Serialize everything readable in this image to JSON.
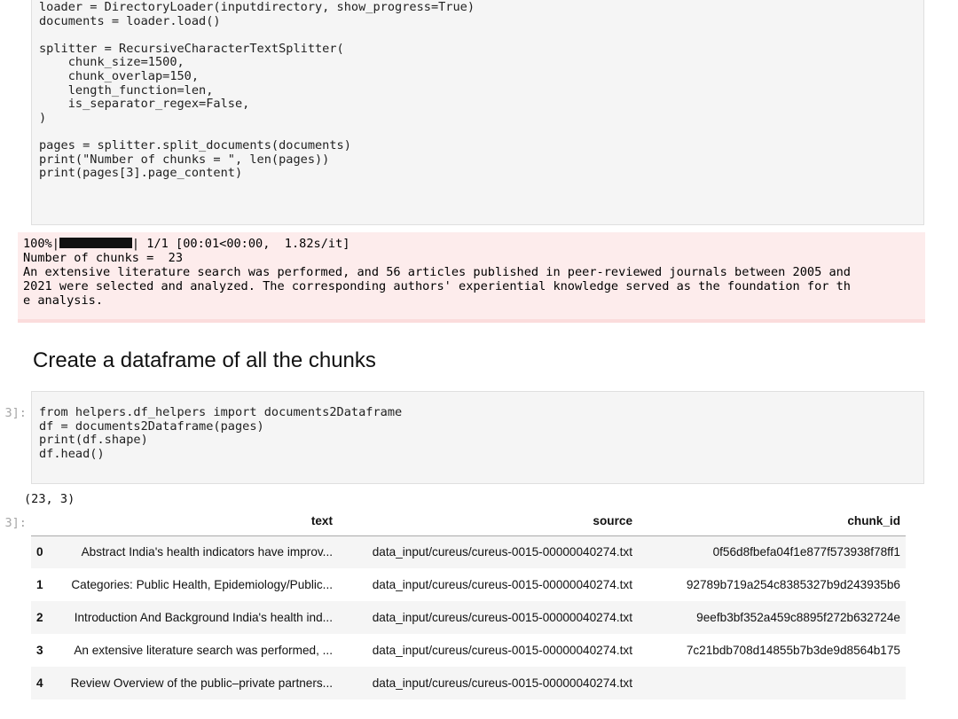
{
  "cell1": {
    "lines": [
      "loader = DirectoryLoader(inputdirectory, show_progress=True)",
      "documents = loader.load()",
      "",
      "splitter = RecursiveCharacterTextSplitter(",
      "    chunk_size=1500,",
      "    chunk_overlap=150,",
      "    length_function=len,",
      "    is_separator_regex=False,",
      ")",
      "",
      "pages = splitter.split_documents(documents)",
      "print(\"Number of chunks = \", len(pages))",
      "print(pages[3].page_content)"
    ]
  },
  "stderr": {
    "progress_prefix": "100%|",
    "progress_suffix": "| 1/1 [00:01<00:00,  1.82s/it]",
    "progress_fraction": 1.0
  },
  "stdout1": {
    "lines": [
      "Number of chunks =  23",
      "An extensive literature search was performed, and 56 articles published in peer-reviewed journals between 2005 and",
      "2021 were selected and analyzed. The corresponding authors' experiential knowledge served as the foundation for th",
      "e analysis."
    ]
  },
  "heading": "Create a dataframe of all the chunks",
  "cell2": {
    "prompt": "3]:",
    "lines": [
      "from helpers.df_helpers import documents2Dataframe",
      "df = documents2Dataframe(pages)",
      "print(df.shape)",
      "df.head()"
    ]
  },
  "stdout2": "(23, 3)",
  "out_prompt": "3]:",
  "table": {
    "columns": [
      "",
      "text",
      "source",
      "chunk_id"
    ],
    "rows": [
      {
        "index": "0",
        "text": "Abstract India's health indicators have improv...",
        "source": "data_input/cureus/cureus-0015-00000040274.txt",
        "chunk_id": "0f56d8fbefa04f1e877f573938f78ff1"
      },
      {
        "index": "1",
        "text": "Categories: Public Health, Epidemiology/Public...",
        "source": "data_input/cureus/cureus-0015-00000040274.txt",
        "chunk_id": "92789b719a254c8385327b9d243935b6"
      },
      {
        "index": "2",
        "text": "Introduction And Background India's health ind...",
        "source": "data_input/cureus/cureus-0015-00000040274.txt",
        "chunk_id": "9eefb3bf352a459c8895f272b632724e"
      },
      {
        "index": "3",
        "text": "An extensive literature search was performed, ...",
        "source": "data_input/cureus/cureus-0015-00000040274.txt",
        "chunk_id": "7c21bdb708d14855b7b3de9d8564b175"
      },
      {
        "index": "4",
        "text": "Review Overview of the public–private partners...",
        "source": "data_input/cureus/cureus-0015-00000040274.txt",
        "chunk_id": ""
      }
    ]
  }
}
